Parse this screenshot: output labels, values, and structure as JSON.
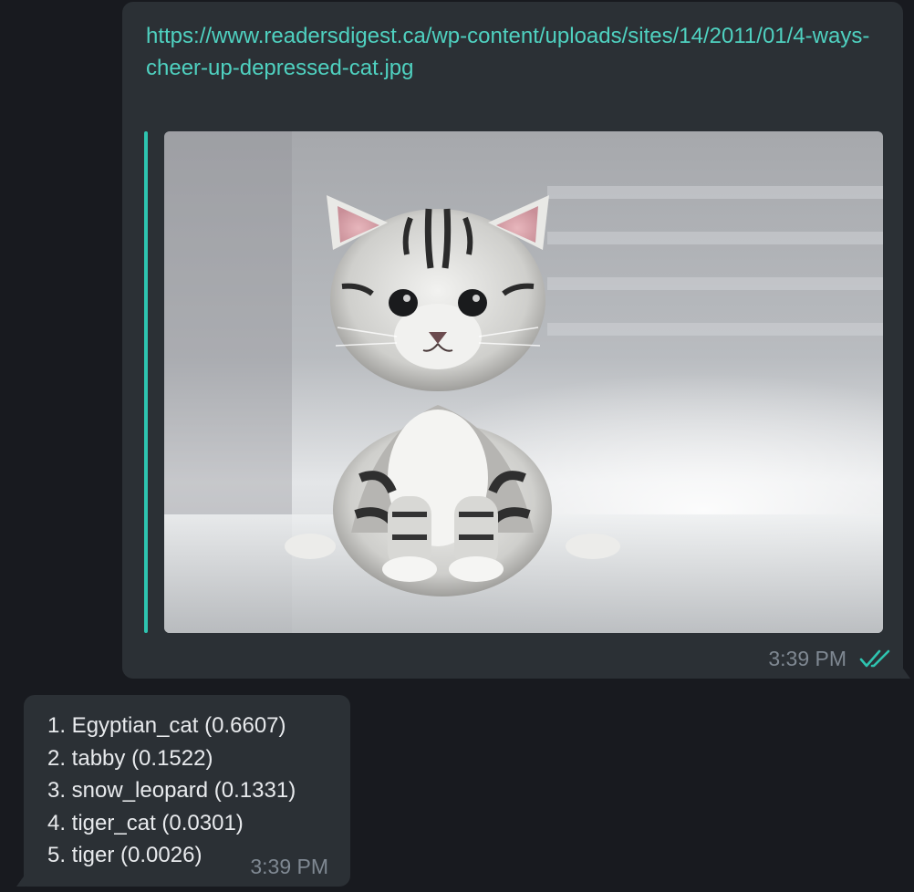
{
  "outgoing_message": {
    "link": "https://www.readersdigest.ca/wp-content/uploads/sites/14/2011/01/4-ways-cheer-up-depressed-cat.jpg",
    "image_icon": "kitten-photo",
    "time": "3:39 PM",
    "status_icon": "double-check-icon",
    "accent_color": "#2ec4b0",
    "link_color": "#4fd1c0"
  },
  "incoming_message": {
    "results": [
      "1. Egyptian_cat (0.6607)",
      "2. tabby (0.1522)",
      "3. snow_leopard (0.1331)",
      "4. tiger_cat (0.0301)",
      "5. tiger (0.0026)"
    ],
    "time": "3:39 PM"
  },
  "theme": {
    "background": "#181a1f",
    "bubble": "#2b3035",
    "text": "#e8eaed",
    "timestamp": "#7f8892"
  }
}
